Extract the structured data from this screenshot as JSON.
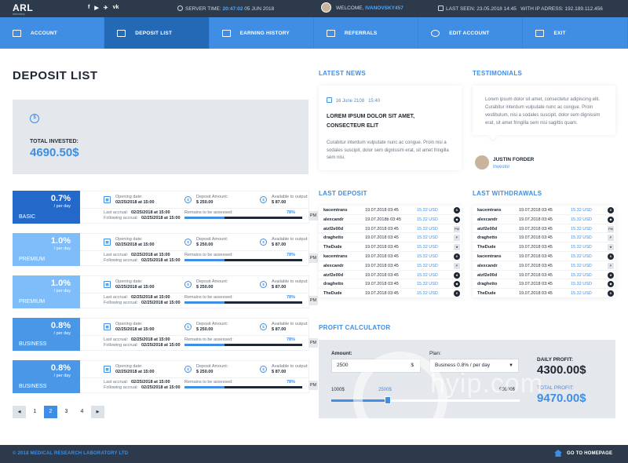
{
  "topbar": {
    "logo": "ARL",
    "logo_sub": "laboratory",
    "social": [
      "f",
      "▶",
      "✈",
      "vk"
    ],
    "server_time_label": "SERVER TIME:",
    "server_time": "20:47:02",
    "server_date": "05 JUN 2018",
    "welcome_label": "WELCOME,",
    "username": "IVANOVSKY457",
    "last_seen_label": "LAST SEEN:",
    "last_seen": "23.05.2018  14:45",
    "ip_label": "WITH IP ADRESS:",
    "ip": "192.189.112.456"
  },
  "nav": [
    {
      "label": "ACCOUNT"
    },
    {
      "label": "DEPOSIT LIST"
    },
    {
      "label": "EARNING HISTORY"
    },
    {
      "label": "REFERRALS"
    },
    {
      "label": "EDIT ACCOUNT"
    },
    {
      "label": "EXIT"
    }
  ],
  "page_title": "DEPOSIT LIST",
  "invested": {
    "label": "TOTAL INVESTED:",
    "value": "4690.50$",
    "icon": "$"
  },
  "plans": [
    {
      "pct": "0.7%",
      "per": "/ per day",
      "name": "BASIC",
      "color": "#2369c9",
      "opening_label": "Opening date:",
      "opening": "02/25/2018 at 15:00",
      "amount_label": "Deposit Amount:",
      "amount": "$ 250.00",
      "output_label": "Available to output:",
      "output": "$ 87.00",
      "accrual_label": "Last accrual:",
      "accrual": "02/25/2018 at 15:00",
      "following_label": "Following accrual:",
      "following": "02/25/2018 at 15:00",
      "remains_label": "Remains to be assessed:",
      "remains": "78%",
      "progress": 0.34,
      "badge": "PM"
    },
    {
      "pct": "1.0%",
      "per": "/ per day",
      "name": "PREMIUM",
      "color": "#7fbdfa",
      "opening_label": "Opening date:",
      "opening": "02/25/2018 at 15:00",
      "amount_label": "Deposit Amount:",
      "amount": "$ 250.00",
      "output_label": "Available to output:",
      "output": "$ 87.00",
      "accrual_label": "Last accrual:",
      "accrual": "02/25/2018 at 15:00",
      "following_label": "Following accrual:",
      "following": "02/25/2018 at 15:00",
      "remains_label": "Remains to be assessed:",
      "remains": "78%",
      "progress": 0.34,
      "badge": "PM"
    },
    {
      "pct": "1.0%",
      "per": "/ per day",
      "name": "PREMIUM",
      "color": "#7fbdfa",
      "opening_label": "Opening date:",
      "opening": "02/25/2018 at 15:00",
      "amount_label": "Deposit Amount:",
      "amount": "$ 250.00",
      "output_label": "Available to output:",
      "output": "$ 87.00",
      "accrual_label": "Last accrual:",
      "accrual": "02/25/2018 at 15:00",
      "following_label": "Following accrual:",
      "following": "02/25/2018 at 15:00",
      "remains_label": "Remains to be assessed:",
      "remains": "78%",
      "progress": 0.34,
      "badge": "PM"
    },
    {
      "pct": "0.8%",
      "per": "/ per day",
      "name": "BUSINESS",
      "color": "#4a97e8",
      "opening_label": "Opening date:",
      "opening": "02/25/2018 at 15:00",
      "amount_label": "Deposit Amount:",
      "amount": "$ 250.00",
      "output_label": "Available to output:",
      "output": "$ 87.00",
      "accrual_label": "Last accrual:",
      "accrual": "02/25/2018 at 15:00",
      "following_label": "Following accrual:",
      "following": "02/25/2018 at 15:00",
      "remains_label": "Remains to be assessed:",
      "remains": "78%",
      "progress": 0.34,
      "badge": "PM"
    },
    {
      "pct": "0.8%",
      "per": "/ per day",
      "name": "BUSINESS",
      "color": "#4a97e8",
      "opening_label": "Opening date:",
      "opening": "02/25/2018 at 15:00",
      "amount_label": "Deposit Amount:",
      "amount": "$ 250.00",
      "output_label": "Available to output:",
      "output": "$ 87.00",
      "accrual_label": "Last accrual:",
      "accrual": "02/25/2018 at 15:00",
      "following_label": "Following accrual:",
      "following": "02/25/2018 at 15:00",
      "remains_label": "Remains to be assessed:",
      "remains": "78%",
      "progress": 0.34,
      "badge": "PM"
    }
  ],
  "pager": {
    "prev": "◀",
    "next": "▶",
    "pages": [
      "1",
      "2",
      "3",
      "4"
    ],
    "active": 1
  },
  "news": {
    "heading": "LATEST NEWS",
    "date": "16 June 2108",
    "time": "15:40",
    "title": "LOREM IPSUM DOLOR SIT AMET, CONSECTEUR ELIT",
    "text": "Curabitur interdum vulputate nunc ac congue. Proin nisi a sodales suscipit, dolor sem dignissim erat, sit amet fringilla sem nisi."
  },
  "testimonials": {
    "heading": "TESTIMONIALS",
    "text": "Lorem ipsum dolor sit amet, consectetur adipiscing elit. Curabitur interdum vulputate nunc ac congue. Proin vestibulum, nisi a sodales suscipit, dolor sem dignissim erat, sit amet fringilla sem nisi sagittis quam.",
    "name": "JUSTIN FORDER",
    "role": "Investor"
  },
  "last_deposit": {
    "heading": "LAST DEPOSIT",
    "rows": [
      {
        "user": "kacemtrans",
        "date": "19.07.2018 03:45",
        "amount": "15.32 USD",
        "sys": "B",
        "sq": false
      },
      {
        "user": "alexcandr",
        "date": "19.07.2018b 03:45",
        "amount": "15.32 USD",
        "sys": "◆",
        "sq": false
      },
      {
        "user": "atzf2e00d",
        "date": "19.07.2018 03:45",
        "amount": "15.32 USD",
        "sys": "PM",
        "sq": true
      },
      {
        "user": "draghetto",
        "date": "19.07.2018 03:45",
        "amount": "15.32 USD",
        "sys": "P",
        "sq": true
      },
      {
        "user": "TheDude",
        "date": "19.07.2018 03:45",
        "amount": "15.32 USD",
        "sys": "★",
        "sq": true
      },
      {
        "user": "kacemtrans",
        "date": "19.07.2018 03:45",
        "amount": "15.32 USD",
        "sys": "B",
        "sq": false
      },
      {
        "user": "alexcandr",
        "date": "19.07.2018 03:45",
        "amount": "15.32 USD",
        "sys": "P",
        "sq": true
      },
      {
        "user": "atzf2e00d",
        "date": "19.07.2018 03:45",
        "amount": "15.32 USD",
        "sys": "★",
        "sq": false
      },
      {
        "user": "draghetto",
        "date": "19.07.2018 03:45",
        "amount": "15.32 USD",
        "sys": "◆",
        "sq": false
      },
      {
        "user": "TheDude",
        "date": "19.07.2018 03:45",
        "amount": "15.32 USD",
        "sys": "B",
        "sq": false
      }
    ]
  },
  "last_withdrawals": {
    "heading": "LAST WITHDRAWALS",
    "rows": [
      {
        "user": "kacemtrans",
        "date": "19.07.2018 03:45",
        "amount": "15.32 USD",
        "sys": "B",
        "sq": false
      },
      {
        "user": "alexcandr",
        "date": "19.07.2018 03:45",
        "amount": "15.32 USD",
        "sys": "◆",
        "sq": false
      },
      {
        "user": "atzf2e00d",
        "date": "19.07.2018 03:45",
        "amount": "15.32 USD",
        "sys": "PM",
        "sq": true
      },
      {
        "user": "draghetto",
        "date": "19.07.2018 03:45",
        "amount": "15.32 USD",
        "sys": "P",
        "sq": true
      },
      {
        "user": "TheDude",
        "date": "19.07.2018 03:45",
        "amount": "15.32 USD",
        "sys": "★",
        "sq": true
      },
      {
        "user": "kacemtrans",
        "date": "19.07.2018 03:45",
        "amount": "15.32 USD",
        "sys": "B",
        "sq": false
      },
      {
        "user": "alexcandr",
        "date": "19.07.2018 03:45",
        "amount": "15.32 USD",
        "sys": "P",
        "sq": true
      },
      {
        "user": "atzf2e00d",
        "date": "19.07.2018 03:45",
        "amount": "15.32 USD",
        "sys": "★",
        "sq": false
      },
      {
        "user": "draghetto",
        "date": "19.07.2018 03:45",
        "amount": "15.32 USD",
        "sys": "◆",
        "sq": false
      },
      {
        "user": "TheDude",
        "date": "19.07.2018 03:45",
        "amount": "15.32 USD",
        "sys": "B",
        "sq": false
      }
    ]
  },
  "calc": {
    "heading": "PROFIT CALCULATOR",
    "amount_label": "Amount:",
    "amount": "2500",
    "currency": "$",
    "plan_label": "Plan:",
    "plan": "Business 0.8% / per day",
    "min": "1000$",
    "current": "2500$",
    "max": "50000$",
    "daily_label": "DAILY PROFIT:",
    "daily": "4300.00$",
    "total_label": "TOTAL PROFIT:",
    "total": "9470.00$"
  },
  "watermark": "hyip.com",
  "footer": {
    "copyright": "© 2018 MEDICAL RESEARCH LABORATORY LTD",
    "home": "GO TO HOMEPAGE"
  }
}
